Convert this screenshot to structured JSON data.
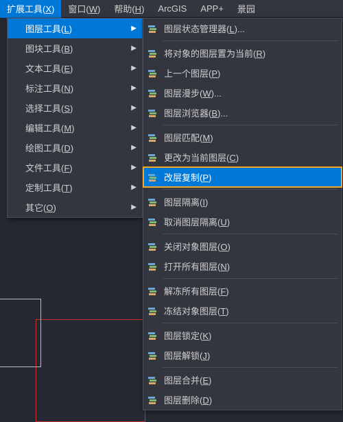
{
  "menubar": {
    "items": [
      {
        "label": "扩展工具(X)",
        "active": true
      },
      {
        "label": "窗口(W)"
      },
      {
        "label": "帮助(H)"
      },
      {
        "label": "ArcGIS"
      },
      {
        "label": "APP+"
      },
      {
        "label": "景园"
      }
    ]
  },
  "dropdown1": {
    "items": [
      {
        "label": "图层工具(L)",
        "highlighted": true
      },
      {
        "label": "图块工具(B)"
      },
      {
        "label": "文本工具(E)"
      },
      {
        "label": "标注工具(N)"
      },
      {
        "label": "选择工具(S)"
      },
      {
        "label": "编辑工具(M)"
      },
      {
        "label": "绘图工具(D)"
      },
      {
        "label": "文件工具(F)"
      },
      {
        "label": "定制工具(T)"
      },
      {
        "label": "其它(O)"
      }
    ]
  },
  "dropdown2": {
    "groups": [
      [
        {
          "label": "图层状态管理器(L)...",
          "icon": "layer-manager-icon"
        }
      ],
      [
        {
          "label": "将对象的图层置为当前(R)",
          "icon": "layer-setcurrent-icon"
        },
        {
          "label": "上一个图层(P)",
          "icon": "layer-prev-icon"
        },
        {
          "label": "图层漫步(W)...",
          "icon": "layer-walk-icon"
        },
        {
          "label": "图层浏览器(B)...",
          "icon": "layer-browser-icon"
        }
      ],
      [
        {
          "label": "图层匹配(M)",
          "icon": "layer-match-icon"
        },
        {
          "label": "更改为当前图层(C)",
          "icon": "layer-changecurr-icon"
        },
        {
          "label": "改层复制(P)",
          "icon": "layer-copy-icon",
          "selected": true
        }
      ],
      [
        {
          "label": "图层隔离(I)",
          "icon": "layer-isolate-icon"
        },
        {
          "label": "取消图层隔离(U)",
          "icon": "layer-unisolate-icon"
        }
      ],
      [
        {
          "label": "关闭对象图层(O)",
          "icon": "layer-off-icon"
        },
        {
          "label": "打开所有图层(N)",
          "icon": "layer-on-icon"
        }
      ],
      [
        {
          "label": "解冻所有图层(F)",
          "icon": "layer-thaw-icon"
        },
        {
          "label": "冻结对象图层(T)",
          "icon": "layer-freeze-icon"
        }
      ],
      [
        {
          "label": "图层锁定(K)",
          "icon": "layer-lock-icon"
        },
        {
          "label": "图层解锁(J)",
          "icon": "layer-unlock-icon"
        }
      ],
      [
        {
          "label": "图层合并(E)",
          "icon": "layer-merge-icon"
        },
        {
          "label": "图层删除(D)",
          "icon": "layer-delete-icon"
        }
      ]
    ]
  }
}
